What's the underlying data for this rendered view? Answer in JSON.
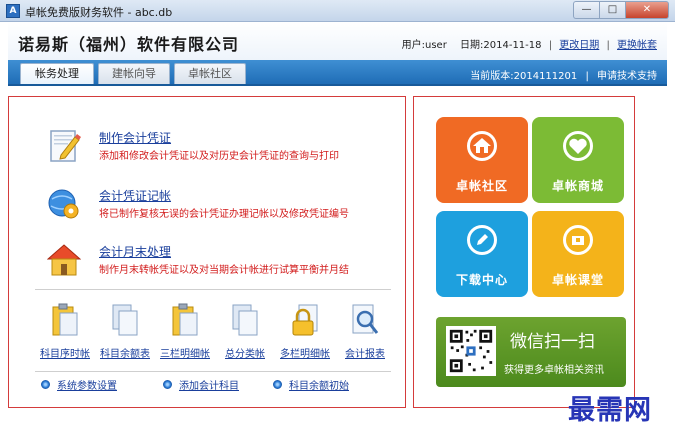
{
  "window": {
    "title": "卓帐免费版财务软件 - abc.db",
    "app_icon_glyph": "A",
    "minimize_glyph": "—",
    "maximize_glyph": "□",
    "close_glyph": "✕"
  },
  "header": {
    "company": "诺易斯（福州）软件有限公司",
    "user": "用户:user",
    "date": "日期:2014-11-18",
    "separator": "|",
    "change_date": "更改日期",
    "switch_ledger": "更换帐套"
  },
  "tabs": [
    {
      "label": "帐务处理",
      "active": true
    },
    {
      "label": "建帐向导",
      "active": false
    },
    {
      "label": "卓帐社区",
      "active": false
    }
  ],
  "tabbar": {
    "version": "当前版本:2014111201",
    "separator": "|",
    "support": "申请技术支持"
  },
  "tasks": [
    {
      "title": "制作会计凭证",
      "desc": "添加和修改会计凭证以及对历史会计凭证的查询与打印",
      "icon": "edit-document-icon"
    },
    {
      "title": "会计凭证记帐",
      "desc": "将已制作复核无误的会计凭证办理记帐以及修改凭证编号",
      "icon": "gear-globe-icon"
    },
    {
      "title": "会计月末处理",
      "desc": "制作月末转帐凭证以及对当期会计帐进行试算平衡并月结",
      "icon": "house-icon"
    }
  ],
  "reports": [
    {
      "label": "科目序时帐",
      "icon": "clipboard-doc-icon"
    },
    {
      "label": "科目余额表",
      "icon": "docs-stack-icon"
    },
    {
      "label": "三栏明细帐",
      "icon": "clipboard-doc-icon"
    },
    {
      "label": "总分类帐",
      "icon": "docs-stack-icon"
    },
    {
      "label": "多栏明细帐",
      "icon": "lock-doc-icon"
    },
    {
      "label": "会计报表",
      "icon": "magnifier-doc-icon"
    }
  ],
  "links": [
    {
      "label": "系统参数设置"
    },
    {
      "label": "添加会计科目"
    },
    {
      "label": "科目余额初始"
    }
  ],
  "tiles": [
    {
      "label": "卓帐社区",
      "color": "#f06a24",
      "icon": "home-icon"
    },
    {
      "label": "卓帐商城",
      "color": "#7cbb35",
      "icon": "heart-icon"
    },
    {
      "label": "下载中心",
      "color": "#1ea0de",
      "icon": "pencil-icon"
    },
    {
      "label": "卓帐课堂",
      "color": "#f4b31a",
      "icon": "folder-icon"
    }
  ],
  "wechat": {
    "title": "微信扫一扫",
    "subtitle": "获得更多卓帐相关资讯"
  },
  "watermark": "最需网",
  "colors": {
    "accent_blue": "#1f6db6",
    "link_blue": "#1a3f9c",
    "panel_border": "#d43b3b",
    "desc_red": "#d21c1c"
  }
}
